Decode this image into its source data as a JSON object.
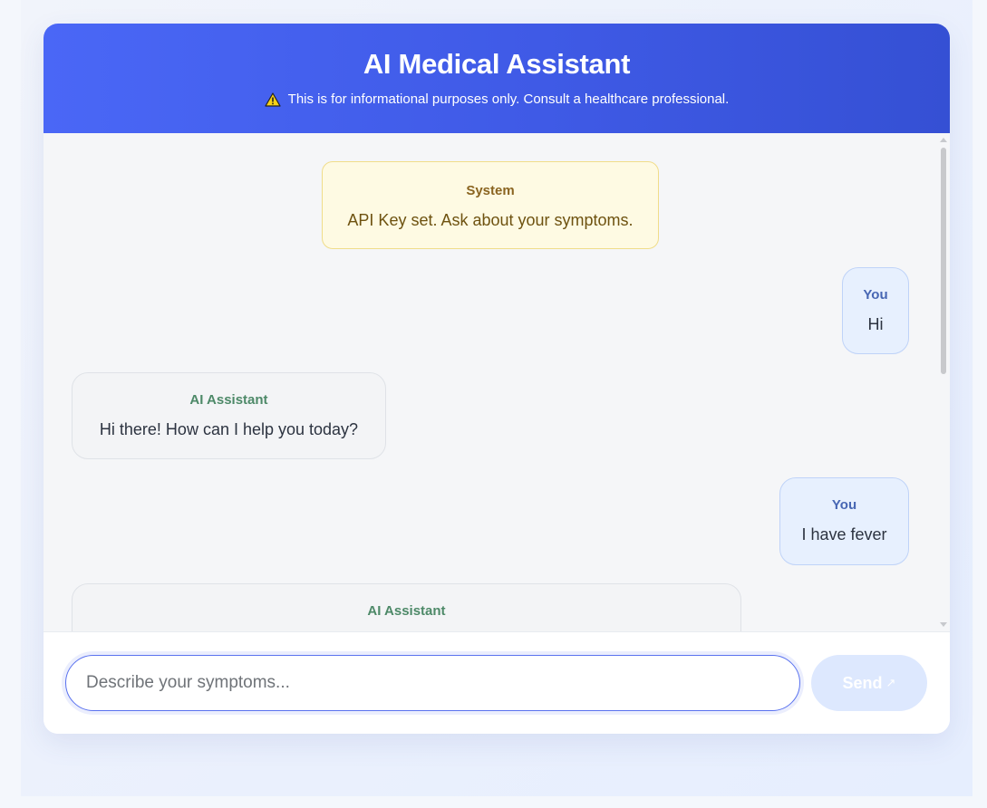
{
  "header": {
    "title": "AI Medical Assistant",
    "disclaimer": "This is for informational purposes only. Consult a healthcare professional.",
    "disclaimer_icon": "warning-icon"
  },
  "messages": [
    {
      "role": "system",
      "sender": "System",
      "text": "API Key set. Ask about your symptoms."
    },
    {
      "role": "user",
      "sender": "You",
      "text": "Hi"
    },
    {
      "role": "ai",
      "sender": "AI Assistant",
      "text": "Hi there! How can I help you today?"
    },
    {
      "role": "user",
      "sender": "You",
      "text": "I have fever"
    },
    {
      "role": "ai",
      "sender": "AI Assistant",
      "text": ""
    }
  ],
  "composer": {
    "placeholder": "Describe your symptoms...",
    "value": "",
    "send_label": "Send",
    "send_icon": "arrow-up-right-icon"
  },
  "colors": {
    "header_start": "#4a67f6",
    "header_end": "#3550d4",
    "system_bg": "#fefae3",
    "user_bg": "#e7f0fe",
    "ai_bg": "#f3f4f6",
    "send_disabled": "#dde8fe"
  }
}
